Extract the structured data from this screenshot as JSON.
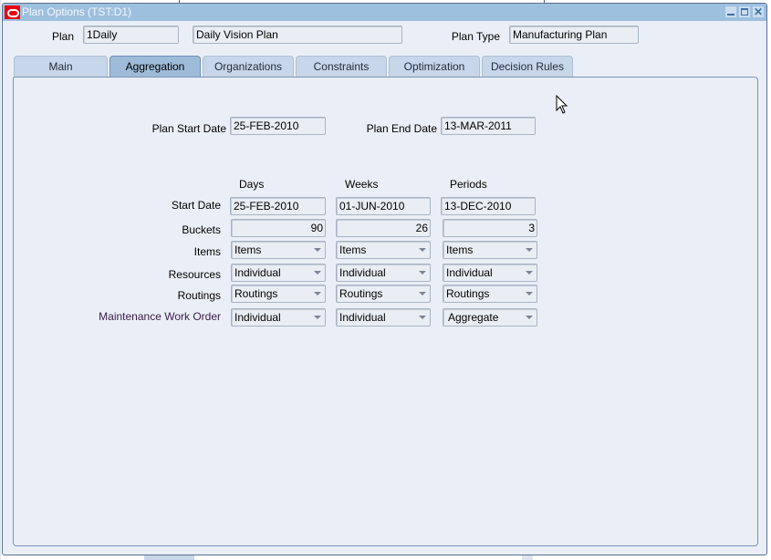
{
  "window": {
    "title": "Plan Options (TST:D1)",
    "controls": [
      "minimize",
      "maximize",
      "close"
    ]
  },
  "header": {
    "plan_label": "Plan",
    "plan_value": "1Daily",
    "plan_description": "Daily Vision Plan",
    "plan_type_label": "Plan Type",
    "plan_type_value": "Manufacturing Plan"
  },
  "tabs": [
    {
      "label": "Main",
      "active": false
    },
    {
      "label": "Aggregation",
      "active": true
    },
    {
      "label": "Organizations",
      "active": false
    },
    {
      "label": "Constraints",
      "active": false
    },
    {
      "label": "Optimization",
      "active": false
    },
    {
      "label": "Decision Rules",
      "active": false
    }
  ],
  "aggregation": {
    "plan_start_date_label": "Plan Start Date",
    "plan_start_date": "25-FEB-2010",
    "plan_end_date_label": "Plan End Date",
    "plan_end_date": "13-MAR-2011",
    "columns": [
      "Days",
      "Weeks",
      "Periods"
    ],
    "rows": {
      "start_date": {
        "label": "Start Date",
        "values": [
          "25-FEB-2010",
          "01-JUN-2010",
          "13-DEC-2010"
        ]
      },
      "buckets": {
        "label": "Buckets",
        "values": [
          "90",
          "26",
          "3"
        ]
      },
      "items": {
        "label": "Items",
        "values": [
          "Items",
          "Items",
          "Items"
        ]
      },
      "resources": {
        "label": "Resources",
        "values": [
          "Individual",
          "Individual",
          "Individual"
        ]
      },
      "routings": {
        "label": "Routings",
        "values": [
          "Routings",
          "Routings",
          "Routings"
        ]
      },
      "maintenance_work_order": {
        "label": "Maintenance Work Order",
        "values": [
          "Individual",
          "Individual",
          "Aggregate"
        ]
      }
    }
  },
  "colors": {
    "titlebar": "#9ec0df",
    "window_bg": "#eaeff7",
    "tab_active": "#9ebcd9",
    "tab_inactive": "#c7d6e8",
    "logo_red": "#e8000f"
  }
}
